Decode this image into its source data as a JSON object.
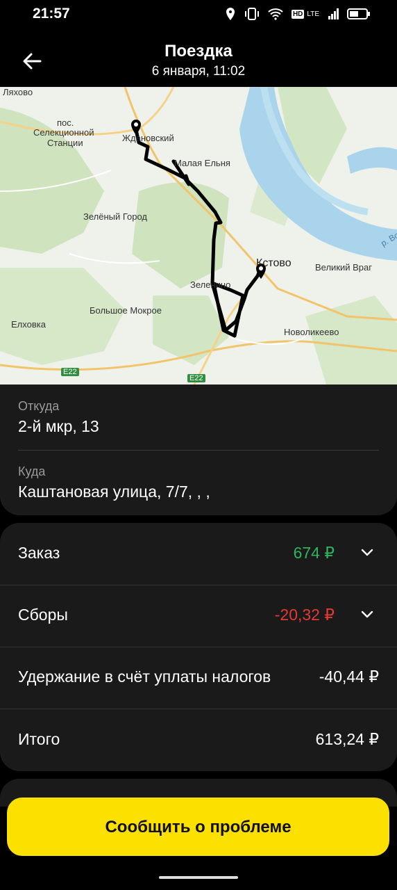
{
  "status_bar": {
    "time": "21:57",
    "network": "LTE"
  },
  "header": {
    "title": "Поездка",
    "subtitle": "6 января, 11:02"
  },
  "map": {
    "labels": {
      "lyakhovo": "Ляхово",
      "pos_1": "пос.",
      "pos_2": "Селекционной",
      "pos_3": "Станции",
      "zhdanovsky": "Ждановский",
      "malaya_elnya": "Малая Ельня",
      "zeleny_gorod": "Зелёный Город",
      "kstovo": "Кстово",
      "veliky_vrag": "Великий Враг",
      "zelenino": "Зеленино",
      "bolshoe_mokroe": "Большое Мокрое",
      "elkhovka": "Елховка",
      "novolikeevo": "Новоликеево",
      "road_e22_a": "E22",
      "road_e22_b": "E22",
      "river_label": "р. Во"
    }
  },
  "route": {
    "from_label": "Откуда",
    "from_value": "2-й мкр, 13",
    "to_label": "Куда",
    "to_value": "Каштановая улица, 7/7, , ,"
  },
  "finance": {
    "order_label": "Заказ",
    "order_value": "674 ₽",
    "fees_label": "Сборы",
    "fees_value": "-20,32 ₽",
    "tax_label": "Удержание в счёт уплаты налогов",
    "tax_value": "-40,44 ₽",
    "total_label": "Итого",
    "total_value": "613,24 ₽",
    "colors": {
      "positive": "#2fb45e",
      "negative": "#e53935"
    }
  },
  "actions": {
    "report_button": "Сообщить о проблеме"
  },
  "icons": [
    "location-icon",
    "vibrate-icon",
    "wifi-icon",
    "hd-icon",
    "signal-icon",
    "battery-icon",
    "back-arrow-icon",
    "chevron-down-icon",
    "map-pin-icon"
  ]
}
